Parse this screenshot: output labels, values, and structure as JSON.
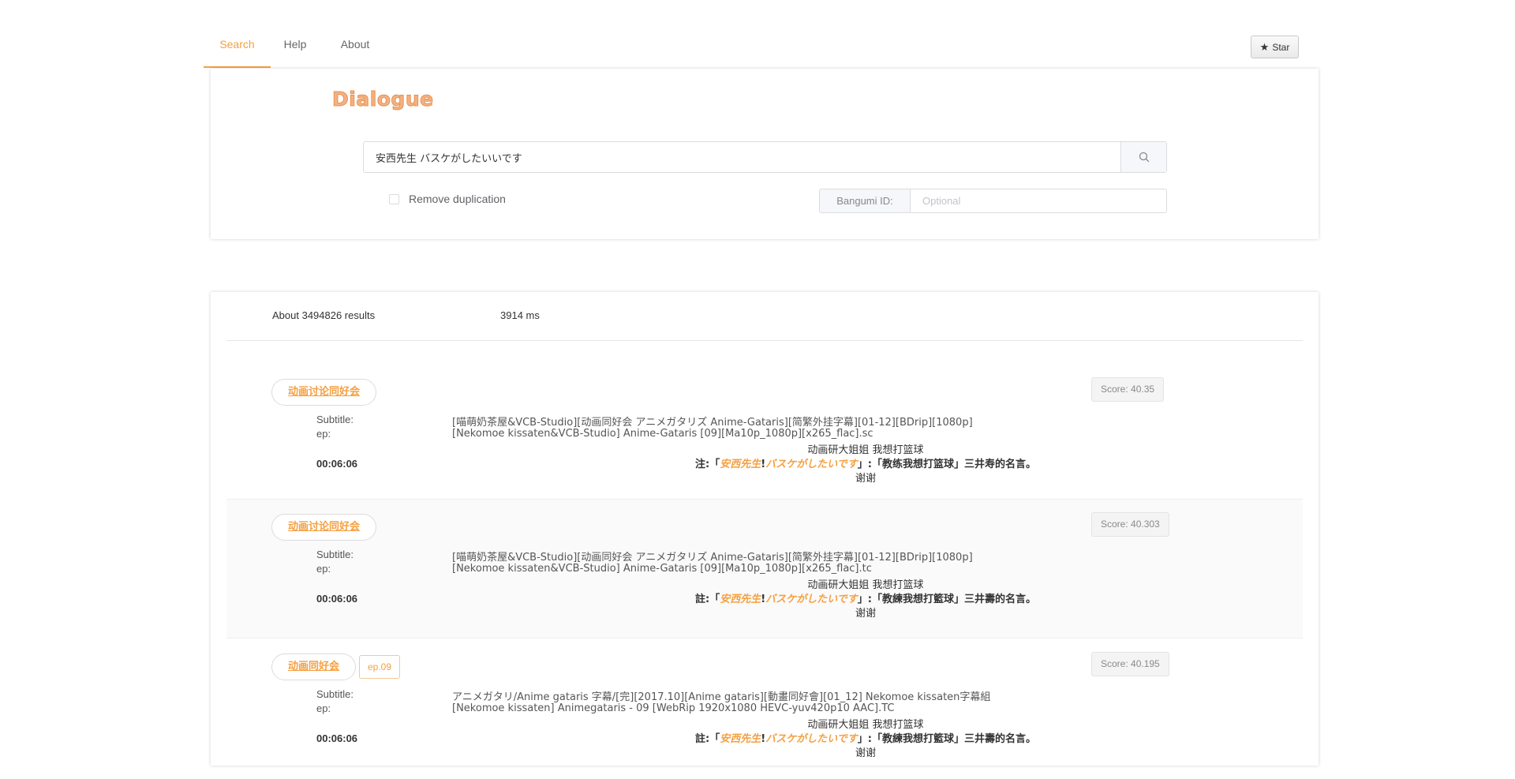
{
  "nav": {
    "tabs": [
      {
        "label": "Search",
        "active": true
      },
      {
        "label": "Help",
        "active": false
      },
      {
        "label": "About",
        "active": false
      }
    ],
    "star_label": "Star"
  },
  "search": {
    "logo": "Dialogue",
    "query": "安西先生 バスケがしたいいです",
    "dedupe_label": "Remove duplication",
    "dedupe_checked": false,
    "bangumi_label": "Bangumi ID:",
    "bangumi_placeholder": "Optional"
  },
  "stats": {
    "results": "About 3494826 results",
    "time": "3914 ms"
  },
  "labels": {
    "subtitle": "Subtitle:",
    "ep": "ep:"
  },
  "results": [
    {
      "anime": "动画讨论同好会",
      "ep_tag": "",
      "score": "Score: 40.35",
      "subtitle": "[喵萌奶茶屋&VCB-Studio][动画同好会 アニメガタリズ Anime-Gataris][简繁外挂字幕][01-12][BDrip][1080p]",
      "ep": "[Nekomoe kissaten&VCB-Studio] Anime-Gataris [09][Ma10p_1080p][x265_flac].sc",
      "time": "00:06:06",
      "line1": "动画研大姐姐 我想打篮球",
      "line2_pre": "注:「",
      "hl1": "安西先生",
      "line2_mid": "!",
      "hl2": "バスケがしたいです",
      "line2_post": "」:「教练我想打篮球」三井寿的名言。",
      "line3": "谢谢"
    },
    {
      "anime": "动画讨论同好会",
      "ep_tag": "",
      "score": "Score: 40.303",
      "subtitle": "[喵萌奶茶屋&VCB-Studio][动画同好会 アニメガタリズ Anime-Gataris][简繁外挂字幕][01-12][BDrip][1080p]",
      "ep": "[Nekomoe kissaten&VCB-Studio] Anime-Gataris [09][Ma10p_1080p][x265_flac].tc",
      "time": "00:06:06",
      "line1": "动画研大姐姐 我想打篮球",
      "line2_pre": "註:「",
      "hl1": "安西先生",
      "line2_mid": "!",
      "hl2": "バスケがしたいです",
      "line2_post": "」:「教練我想打籃球」三井壽的名言。",
      "line3": "谢谢"
    },
    {
      "anime": "动画同好会",
      "ep_tag": "ep.09",
      "score": "Score: 40.195",
      "subtitle": "アニメガタリ/Anime gataris 字幕/[完][2017.10][Anime gataris][動畫同好會][01_12] Nekomoe kissaten字幕組",
      "ep": "[Nekomoe kissaten] Animegataris - 09 [WebRip 1920x1080 HEVC-yuv420p10 AAC].TC",
      "time": "00:06:06",
      "line1": "动画研大姐姐 我想打篮球",
      "line2_pre": "註:「",
      "hl1": "安西先生",
      "line2_mid": "!",
      "hl2": "バスケがしたいです",
      "line2_post": "」:「教練我想打籃球」三井壽的名言。",
      "line3": "谢谢"
    }
  ],
  "colors": {
    "accent": "#f5a041",
    "logo_fill": "#f3b183",
    "score_bg": "#f4f4f5"
  }
}
